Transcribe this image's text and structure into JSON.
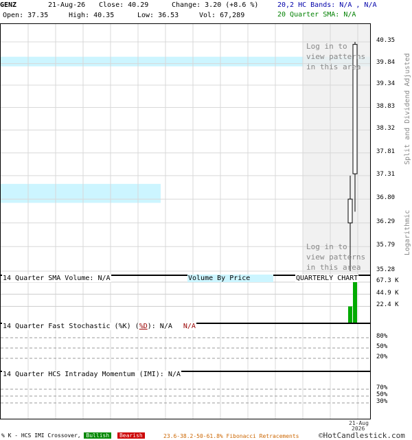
{
  "header": {
    "symbol": "GENZ",
    "date": "21-Aug-26",
    "close_label": "Close: 40.29",
    "change_label": "Change: 3.20 (+8.6 %)",
    "open_label": "Open: 37.35",
    "high_label": "High: 40.35",
    "low_label": "Low: 36.53",
    "vol_label": "Vol: 67,289",
    "hc_bands": "20,2 HC Bands: N/A , N/A",
    "sma_label": "20 Quarter SMA: N/A"
  },
  "side_labels": {
    "adjusted": "Split and Dividend Adjusted",
    "log": "Logarithmic"
  },
  "login_text": "Log in to\nview patterns\nin this area",
  "panels": {
    "volume_label": "14 Quarter SMA Volume: N/A",
    "volume_by_price": "Volume By Price",
    "chart_period": "QUARTERLY CHART",
    "stoch_label_prefix": "14 Quarter Fast Stochastic (",
    "stoch_k": "%K",
    "stoch_mid": ") (",
    "stoch_d": "%D",
    "stoch_suffix": "): N/A",
    "stoch_na": "N/A",
    "imi_label": "14 Quarter HCS Intraday Momentum (IMI): N/A"
  },
  "x_axis": {
    "date": "21-Aug",
    "year": "2026"
  },
  "footer": {
    "crossover": "% K - HCS IMI Crossover,",
    "bullish": "Bullish",
    "bearish": "Bearish",
    "fib": "23.6-38.2-50-61.8% Fibonacci Retracements",
    "brand": "©HotCandlestick.com"
  },
  "colors": {
    "volume_bar": "#00aa00",
    "band_fill": "#ccf5ff",
    "bullish": "#008800",
    "bearish": "#cc0000"
  },
  "chart_data": {
    "type": "candlestick",
    "scale": "log",
    "price_ticks": [
      "40.35",
      "39.84",
      "39.34",
      "38.83",
      "38.32",
      "37.81",
      "37.31",
      "36.80",
      "36.29",
      "35.79",
      "35.28"
    ],
    "ylim": [
      35.28,
      40.35
    ],
    "candles": [
      {
        "open": 36.29,
        "high": 37.31,
        "low": 35.28,
        "close": 36.8
      },
      {
        "open": 37.35,
        "high": 40.35,
        "low": 36.53,
        "close": 40.29
      }
    ],
    "volume_ticks": [
      "67.3 K",
      "44.9 K",
      "22.4 K"
    ],
    "volume": [
      22400,
      67289
    ],
    "stoch_ticks": [
      "80%",
      "50%",
      "20%"
    ],
    "imi_ticks": [
      "70%",
      "50%",
      "30%"
    ]
  }
}
